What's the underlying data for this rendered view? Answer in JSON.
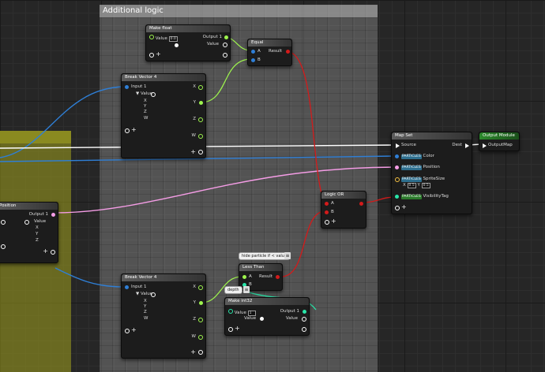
{
  "comments": {
    "main": "Additional logic",
    "yellow": ""
  },
  "colors": {
    "float": "#9ef54d",
    "vector": "#f5c242",
    "bool": "#d31b1b",
    "exec": "#ffffff",
    "struct": "#2f7fd6",
    "particle": "#f59de6",
    "integer": "#29e6a9"
  },
  "nodes": {
    "make_float": {
      "title": "Make float",
      "value_label": "Value",
      "value_field": "0.0",
      "output": "Output 1",
      "value_out": "Value"
    },
    "equal": {
      "title": "Equal",
      "a": "A",
      "b": "B",
      "result": "Result"
    },
    "break_vector_top": {
      "title": "Break Vector 4",
      "input": "Input 1",
      "value": "Value",
      "x": "X",
      "y": "Y",
      "z": "Z",
      "w": "W"
    },
    "map_set": {
      "title": "Map Set",
      "source": "Source",
      "dest": "Dest",
      "color_tag": "PARTICLES",
      "color": "Color",
      "position_tag": "PARTICLES",
      "position": "Position",
      "size_tag": "PARTICLES",
      "size": "SpriteSize",
      "size_x_label": "X",
      "size_x": "0.5",
      "size_y_label": "Y",
      "size_y": "0.5",
      "vis_tag": "PARTICLES",
      "vis": "VisibilityTag"
    },
    "output_module": {
      "title": "Output Module",
      "output": "OutputMap"
    },
    "logic_or": {
      "title": "Logic OR",
      "a": "A",
      "b": "B"
    },
    "position": {
      "title": "Position",
      "output": "Output 1",
      "value": "Value",
      "x": "X",
      "y": "Y",
      "z": "Z"
    },
    "hide_note": {
      "text": "hide particle if < value"
    },
    "less_than": {
      "title": "Less Than",
      "a": "A",
      "b": "B",
      "result": "Result"
    },
    "depth_note": {
      "text": "depth"
    },
    "break_vector_bottom": {
      "title": "Break Vector 4",
      "input": "Input 1",
      "value": "Value",
      "x": "X",
      "y": "Y",
      "z": "Z",
      "w": "W"
    },
    "make_int": {
      "title": "Make int32",
      "value_label": "Value",
      "value_field": "1",
      "output": "Output 1",
      "value_out": "Value"
    }
  }
}
